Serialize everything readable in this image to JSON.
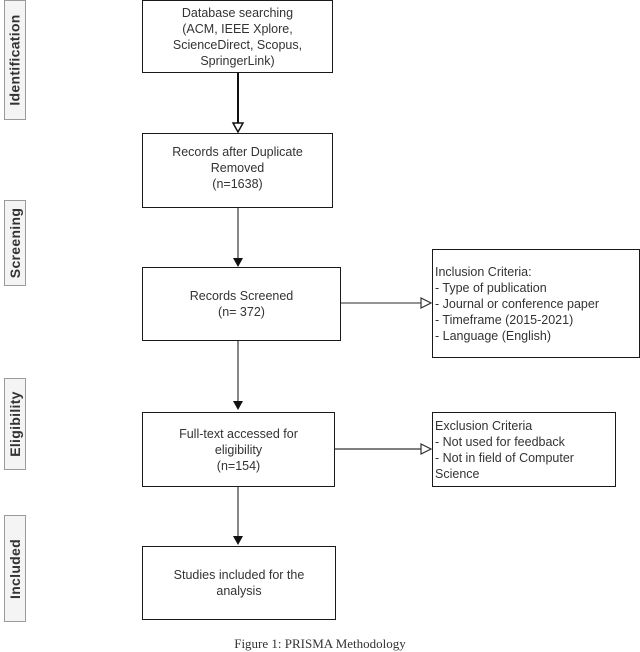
{
  "stages": {
    "identification": "Identification",
    "screening": "Screening",
    "eligibility": "Eligibility",
    "included": "Included"
  },
  "boxes": {
    "database_searching": {
      "lines": [
        "Database searching",
        "(ACM, IEEE Xplore,",
        "ScienceDirect, Scopus,",
        "SpringerLink)"
      ]
    },
    "duplicates_removed": {
      "lines": [
        "Records after Duplicate",
        "Removed",
        "(n=1638)"
      ]
    },
    "records_screened": {
      "lines": [
        "Records Screened",
        "(n= 372)"
      ]
    },
    "full_text": {
      "lines": [
        "Full-text accessed for",
        "eligibility",
        "(n=154)"
      ]
    },
    "studies_included": {
      "lines": [
        "Studies included for the",
        "analysis"
      ]
    },
    "inclusion_criteria": {
      "lines": [
        "Inclusion Criteria:",
        "- Type of publication",
        "- Journal or conference paper",
        "- Timeframe (2015-2021)",
        "- Language (English)"
      ]
    },
    "exclusion_criteria": {
      "lines": [
        "Exclusion Criteria",
        "- Not used for feedback",
        "- Not in field of Computer",
        "Science"
      ]
    }
  },
  "caption": "Figure 1: PRISMA Methodology",
  "colors": {
    "stroke": "#1a1a1a",
    "stage_fill": "#f4f4f4",
    "stage_border": "#9a9a9a"
  }
}
